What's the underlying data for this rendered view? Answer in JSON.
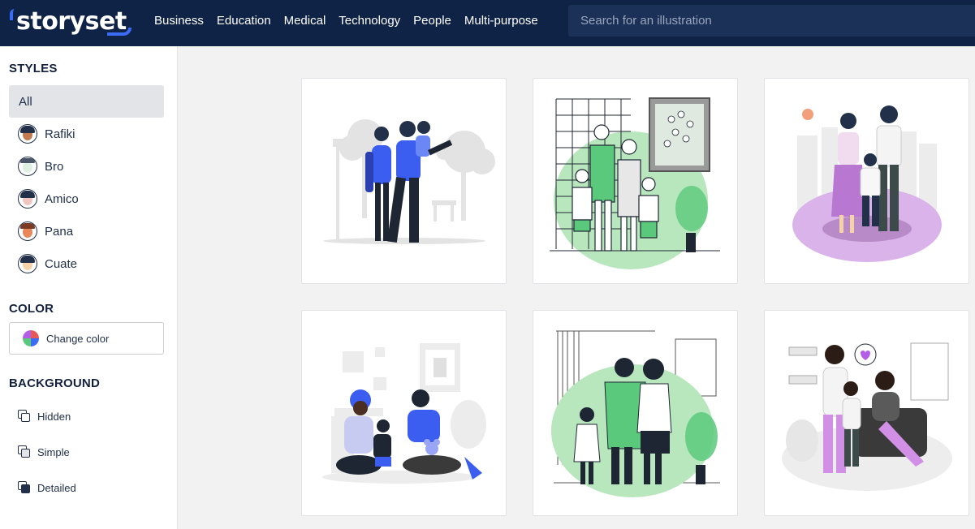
{
  "app": {
    "logo_text": "storyset"
  },
  "nav": {
    "items": [
      "Business",
      "Education",
      "Medical",
      "Technology",
      "People",
      "Multi-purpose"
    ]
  },
  "search": {
    "placeholder": "Search for an illustration"
  },
  "sidebar": {
    "styles_title": "STYLES",
    "styles": [
      "All",
      "Rafiki",
      "Bro",
      "Amico",
      "Pana",
      "Cuate"
    ],
    "selected_style": "All",
    "color_title": "COLOR",
    "change_color_label": "Change color",
    "background_title": "BACKGROUND",
    "backgrounds": [
      "Hidden",
      "Simple",
      "Detailed"
    ]
  },
  "theme": {
    "topbar": "#0f2346",
    "accent_blue": "#3b6cf6",
    "mint": "#5bc97c",
    "lilac": "#b25fe6"
  },
  "gallery": {
    "cards": [
      {
        "name": "family-park-blue",
        "accent": "#3b5ef0"
      },
      {
        "name": "family-wall-green",
        "accent": "#9fdca6"
      },
      {
        "name": "family-city-purple",
        "accent": "#c98ee0"
      },
      {
        "name": "family-playing-blue",
        "accent": "#3b5ef0"
      },
      {
        "name": "family-traditional-green",
        "accent": "#5bc97c"
      },
      {
        "name": "family-living-room-purple",
        "accent": "#b25fe6"
      }
    ]
  }
}
